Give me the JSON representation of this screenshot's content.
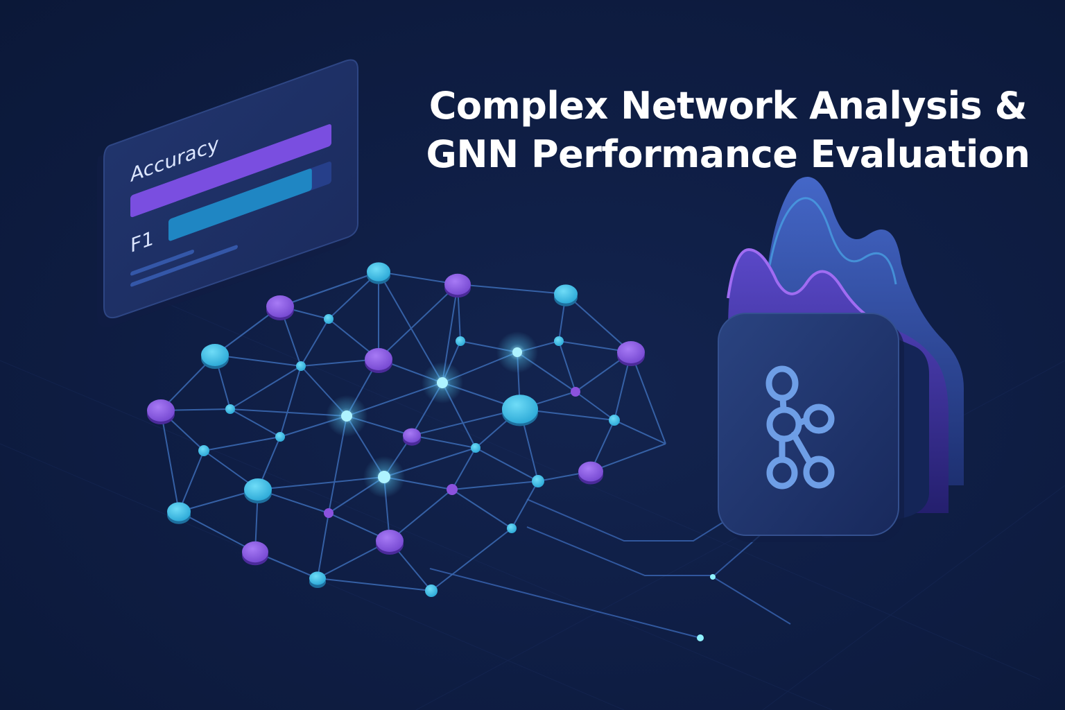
{
  "title": {
    "line1": "Complex Network Analysis &",
    "line2": "GNN Performance Evaluation"
  },
  "metrics_card": {
    "metrics": [
      {
        "label": "Accuracy",
        "level": 1.0,
        "color": "#7a4ee0"
      },
      {
        "label": "F1",
        "level": 0.88,
        "color": "#1f86c3"
      }
    ]
  },
  "icons": {
    "network_card": "graph-network-icon",
    "waves": "mountain-waves-icon"
  },
  "colors": {
    "background": "#0f1e45",
    "node_purple": "#8f5fe6",
    "node_cyan": "#3fc3ea",
    "edge": "#3f6fb0",
    "glow": "#7ee8ff"
  }
}
